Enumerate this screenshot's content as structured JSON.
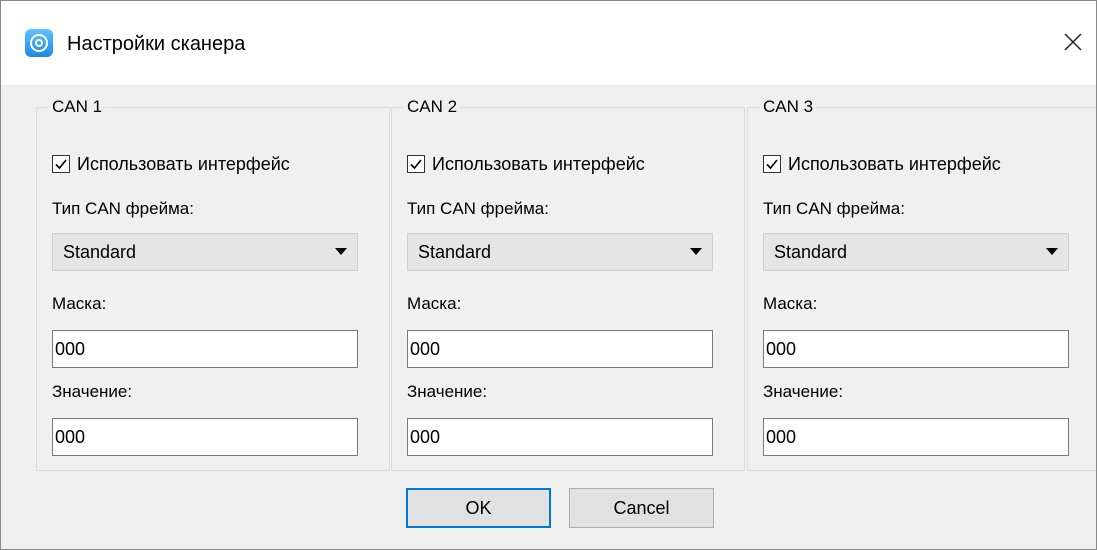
{
  "window": {
    "title": "Настройки сканера",
    "close_glyph": "✕"
  },
  "groups": [
    {
      "title": "CAN 1",
      "use_interface_label": "Использовать интерфейс",
      "use_interface_checked": true,
      "frame_type_label": "Тип CAN фрейма:",
      "frame_type_value": "Standard",
      "mask_label": "Маска:",
      "mask_value": "000",
      "value_label": "Значение:",
      "value_value": "000"
    },
    {
      "title": "CAN 2",
      "use_interface_label": "Использовать интерфейс",
      "use_interface_checked": true,
      "frame_type_label": "Тип CAN фрейма:",
      "frame_type_value": "Standard",
      "mask_label": "Маска:",
      "mask_value": "000",
      "value_label": "Значение:",
      "value_value": "000"
    },
    {
      "title": "CAN 3",
      "use_interface_label": "Использовать интерфейс",
      "use_interface_checked": true,
      "frame_type_label": "Тип CAN фрейма:",
      "frame_type_value": "Standard",
      "mask_label": "Маска:",
      "mask_value": "000",
      "value_label": "Значение:",
      "value_value": "000"
    }
  ],
  "buttons": {
    "ok_label": "OK",
    "cancel_label": "Cancel"
  },
  "colors": {
    "accent": "#0078d7",
    "client_bg": "#f0f0f0",
    "combo_bg": "#e5e5e5"
  },
  "icons": {
    "app": "scanner-app-icon",
    "close": "close-icon",
    "checkbox": "checkmark-icon",
    "dropdown": "dropdown-arrow-icon"
  }
}
